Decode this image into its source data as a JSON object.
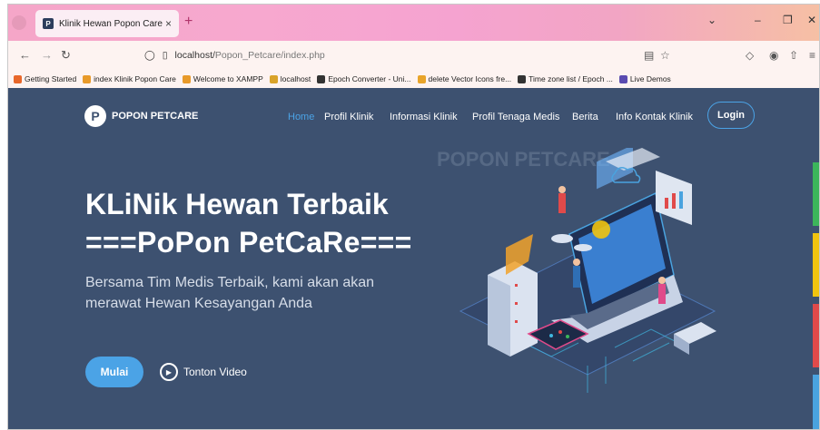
{
  "browser": {
    "tab_title": "Klinik Hewan Popon Care",
    "tab_close": "×",
    "new_tab": "+",
    "url_host": "localhost/",
    "url_path": "Popon_Petcare/index.php",
    "bookmarks": [
      {
        "label": "Getting Started",
        "color": "#e8672a"
      },
      {
        "label": "index Klinik Popon Care",
        "color": "#e89a2a"
      },
      {
        "label": "Welcome to XAMPP",
        "color": "#e89a2a"
      },
      {
        "label": "localhost",
        "color": "#d9a32a"
      },
      {
        "label": "Epoch Converter - Uni...",
        "color": "#333333"
      },
      {
        "label": "delete Vector Icons fre...",
        "color": "#e8a42a"
      },
      {
        "label": "Time zone list / Epoch ...",
        "color": "#333333"
      },
      {
        "label": "Live Demos",
        "color": "#5a4bb0"
      }
    ]
  },
  "site": {
    "logo_letter": "P",
    "logo_name": "POPON PETCARE",
    "nav": [
      {
        "label": "Home",
        "active": true
      },
      {
        "label": "Profil Klinik",
        "active": false
      },
      {
        "label": "Informasi Klinik",
        "active": false
      },
      {
        "label": "Profil Tenaga Medis",
        "active": false
      },
      {
        "label": "Berita",
        "active": false
      },
      {
        "label": "Info Kontak Klinik",
        "active": false
      }
    ],
    "login_label": "Login",
    "watermark": "POPON PETCARE",
    "headline_1": "KLiNik Hewan Terbaik",
    "headline_2": "===PoPon PetCaRe===",
    "subtitle_1": "Bersama Tim Medis Terbaik, kami akan akan",
    "subtitle_2": "merawat Hewan Kesayangan Anda",
    "cta_label": "Mulai",
    "video_label": "Tonton Video"
  },
  "colors": {
    "page_bg": "#3d5170",
    "accent": "#4ba3e6",
    "side_strips": [
      "#3cb55b",
      "#f1c40f",
      "#e04a4a",
      "#4aa3df"
    ]
  }
}
